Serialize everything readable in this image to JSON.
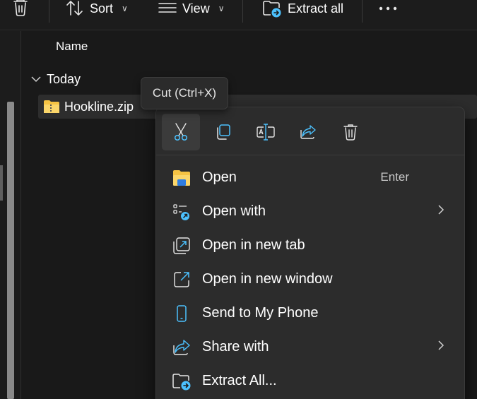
{
  "colors": {
    "accent": "#4cc2ff",
    "folder": "#f6c343",
    "background": "#191919",
    "menu_bg": "#2c2c2c"
  },
  "toolbar": {
    "delete_icon": "trash-icon",
    "sort_label": "Sort",
    "view_label": "View",
    "extract_label": "Extract all",
    "more_icon": "more-icon"
  },
  "list": {
    "column_name": "Name",
    "group_label": "Today",
    "file_name": "Hookline.zip"
  },
  "tooltip": {
    "text": "Cut (Ctrl+X)"
  },
  "context_menu": {
    "quick_actions": [
      {
        "name": "cut",
        "icon": "scissors-icon"
      },
      {
        "name": "copy",
        "icon": "copy-icon"
      },
      {
        "name": "rename",
        "icon": "rename-icon"
      },
      {
        "name": "share",
        "icon": "share-icon"
      },
      {
        "name": "delete",
        "icon": "trash-icon"
      }
    ],
    "items": [
      {
        "label": "Open",
        "shortcut": "Enter",
        "icon": "folder-open-icon"
      },
      {
        "label": "Open with",
        "icon": "open-with-icon",
        "submenu": true
      },
      {
        "label": "Open in new tab",
        "icon": "new-tab-icon"
      },
      {
        "label": "Open in new window",
        "icon": "new-window-icon"
      },
      {
        "label": "Send to My Phone",
        "icon": "phone-icon"
      },
      {
        "label": "Share with",
        "icon": "share-icon",
        "submenu": true
      },
      {
        "label": "Extract All...",
        "icon": "extract-icon"
      }
    ]
  }
}
